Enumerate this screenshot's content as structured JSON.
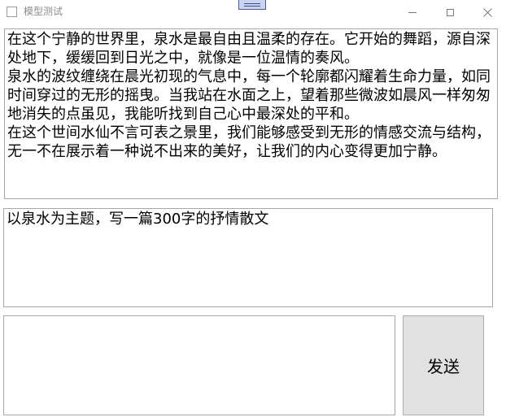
{
  "window": {
    "title": "模型测试"
  },
  "output": {
    "text": "在这个宁静的世界里，泉水是最自由且温柔的存在。它开始的舞蹈，源自深处地下，缓缓回到日光之中，就像是一位温情的奏风。\n泉水的波纹缠绕在晨光初现的气息中，每一个轮廓都闪耀着生命力量，如同时间穿过的无形的摇曳。当我站在水面之上，望着那些微波如晨风一样匆匆地消失的点虽见，我能听找到自己心中最深处的平和。\n在这个世间水仙不言可表之景里，我们能够感受到无形的情感交流与结构，无一不在展示着一种说不出来的美好，让我们的内心变得更加宁静。"
  },
  "prompt": {
    "text": "以泉水为主题，写一篇300字的抒情散文"
  },
  "input": {
    "value": ""
  },
  "send_button": {
    "label": "发送"
  },
  "icons": {
    "app": "app-window-icon",
    "minimize": "minimize-icon",
    "maximize": "maximize-icon",
    "close": "close-icon"
  }
}
